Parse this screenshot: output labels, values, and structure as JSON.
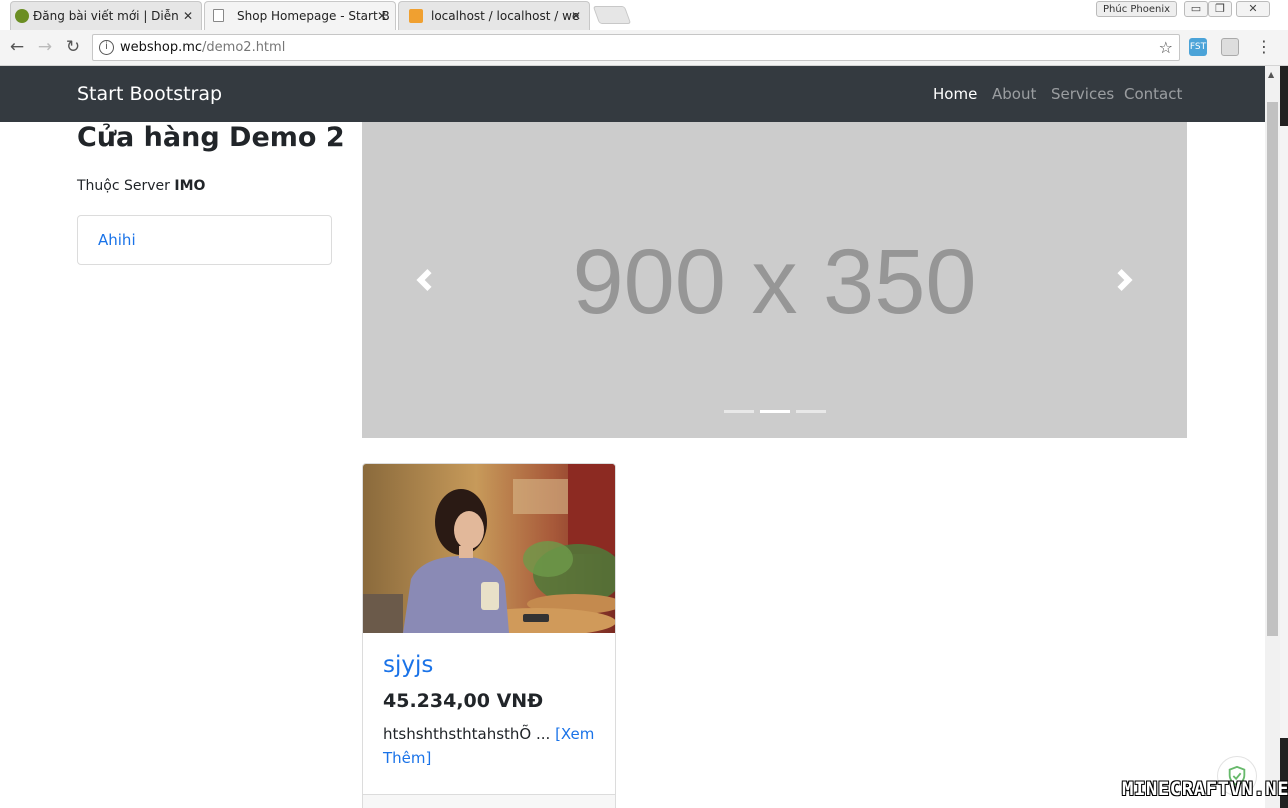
{
  "browser": {
    "tabs": [
      {
        "title": "Đăng bài viết mới | Diễn",
        "close": "✕"
      },
      {
        "title": "Shop Homepage - Start B",
        "close": "✕"
      },
      {
        "title": "localhost / localhost / we",
        "close": "✕"
      }
    ],
    "profile_name": "Phúc Phoenix",
    "url_host": "webshop.mc",
    "url_path": "/demo2.html"
  },
  "navbar": {
    "brand": "Start Bootstrap",
    "links": [
      "Home",
      "About",
      "Services",
      "Contact"
    ]
  },
  "sidebar": {
    "title": "Cửa hàng Demo 2",
    "server_prefix": "Thuộc Server ",
    "server_name": "IMO",
    "list_items": [
      "Ahihi"
    ]
  },
  "carousel": {
    "placeholder_text": "900 x 350",
    "slide_count": 3,
    "active_index": 1
  },
  "product": {
    "name": "sjyjs",
    "price": "45.234,00 VNĐ",
    "description": "htshshthsthtahsthÕ ...",
    "more_link": "[Xem Thêm]"
  },
  "watermark": "MINECRAFTVN.NET",
  "colors": {
    "navbar_bg": "#343a40",
    "link": "#1a73e8",
    "carousel_bg": "#cccccc"
  }
}
